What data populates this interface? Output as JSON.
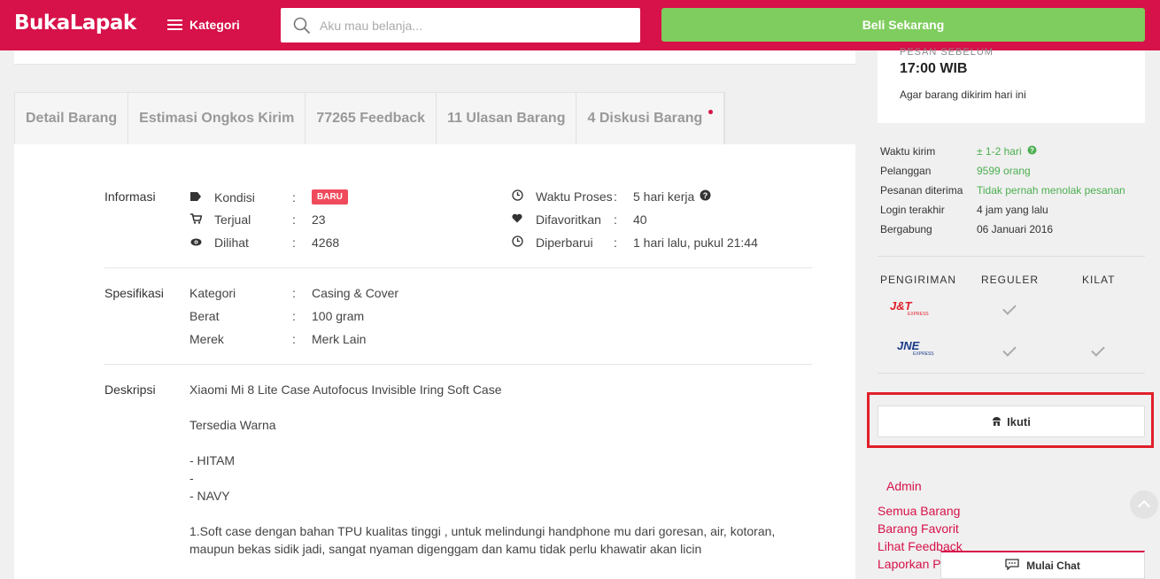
{
  "header": {
    "logo": "BukaLapak",
    "kategori_label": "Kategori",
    "search_placeholder": "Aku mau belanja...",
    "buy_label": "Beli Sekarang"
  },
  "tabs": [
    {
      "label": "Detail Barang"
    },
    {
      "label": "Estimasi Ongkos Kirim"
    },
    {
      "label": "77265 Feedback"
    },
    {
      "label": "11 Ulasan Barang"
    },
    {
      "label": "4 Diskusi Barang",
      "dot": true
    }
  ],
  "informasi": {
    "label": "Informasi",
    "left": [
      {
        "icon": "tag-icon",
        "key": "Kondisi",
        "value": "BARU",
        "badge": true
      },
      {
        "icon": "cart-icon",
        "key": "Terjual",
        "value": "23"
      },
      {
        "icon": "eye-icon",
        "key": "Dilihat",
        "value": "4268"
      }
    ],
    "right": [
      {
        "icon": "clock-icon",
        "key": "Waktu Proses",
        "value": "5 hari kerja"
      },
      {
        "icon": "heart-icon",
        "key": "Difavoritkan",
        "value": "40"
      },
      {
        "icon": "clock-icon",
        "key": "Diperbarui",
        "value": "1 hari lalu, pukul 21:44"
      }
    ]
  },
  "spesifikasi": {
    "label": "Spesifikasi",
    "rows": [
      {
        "key": "Kategori",
        "value": "Casing & Cover"
      },
      {
        "key": "Berat",
        "value": "100 gram"
      },
      {
        "key": "Merek",
        "value": "Merk Lain"
      }
    ]
  },
  "deskripsi": {
    "label": "Deskripsi",
    "lines": [
      "Xiaomi Mi 8 Lite Case Autofocus Invisible Iring Soft Case",
      "",
      "Tersedia Warna",
      "",
      "- HITAM",
      "-",
      "- NAVY",
      "",
      "1.Soft case dengan bahan TPU kualitas tinggi , untuk melindungi handphone mu dari goresan, air, kotoran,",
      "maupun bekas sidik jadi, sangat nyaman digenggam dan kamu tidak perlu khawatir akan licin"
    ]
  },
  "shipping_cutoff": {
    "label": "PESAN SEBELUM",
    "time": "17:00 WIB",
    "note": "Agar barang dikirim hari ini"
  },
  "seller_info": [
    {
      "key": "Waktu kirim",
      "value": "± 1-2 hari",
      "green": true
    },
    {
      "key": "Pelanggan",
      "value": "9599 orang",
      "green": true
    },
    {
      "key": "Pesanan diterima",
      "value": "Tidak pernah menolak pesanan",
      "green": true
    },
    {
      "key": "Login terakhir",
      "value": "4 jam yang lalu"
    },
    {
      "key": "Bergabung",
      "value": "06 Januari 2016"
    }
  ],
  "shipping": {
    "headers": [
      "PENGIRIMAN",
      "REGULER",
      "KILAT"
    ],
    "couriers": [
      {
        "name": "J&T",
        "sub": "EXPRESS",
        "reguler": true,
        "kilat": false
      },
      {
        "name": "JNE",
        "sub": "EXPRESS",
        "reguler": true,
        "kilat": true
      }
    ]
  },
  "follow_label": "Ikuti",
  "admin_label": "Admin",
  "links": [
    "Semua Barang",
    "Barang Favorit",
    "Lihat Feedback",
    "Laporkan P"
  ],
  "chat_label": "Mulai Chat",
  "colors": {
    "brand": "#d71149",
    "buy": "#7ecd5e",
    "green": "#4caf50",
    "highlight": "#e0202a"
  }
}
